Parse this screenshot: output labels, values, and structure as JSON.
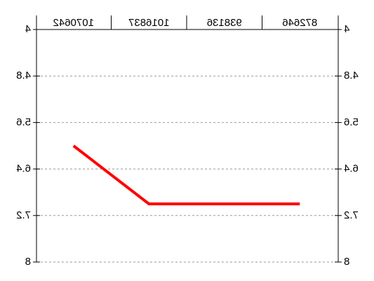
{
  "chart_data": {
    "type": "line",
    "categories": [
      "872646",
      "938136",
      "1016837",
      "1070642"
    ],
    "series": [
      {
        "values": [
          7.0,
          7.0,
          7.0,
          6.0
        ]
      }
    ],
    "ylim": [
      4,
      8
    ],
    "y_ticks": [
      "4",
      "4.8",
      "5.6",
      "6.4",
      "7.2",
      "8"
    ],
    "y_inverted": true,
    "image_mirrored_horizontally": true,
    "x_axis_position": "top",
    "y_axis_both_sides": true,
    "grid": "horizontal dashed",
    "colors": {
      "series": "#ff0000",
      "grid": "#999999",
      "axis": "#000000"
    }
  }
}
